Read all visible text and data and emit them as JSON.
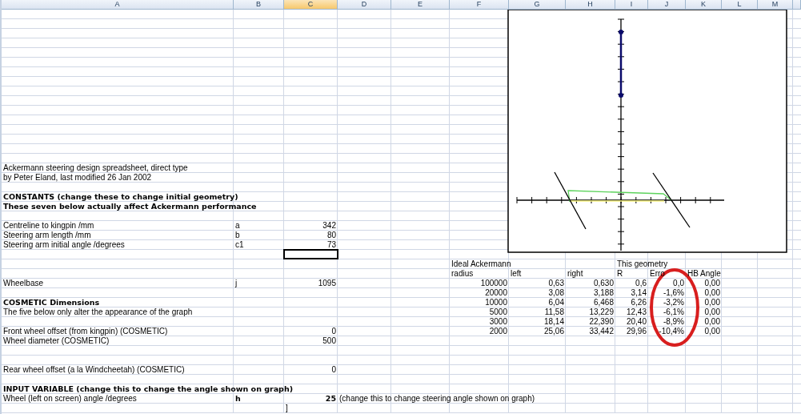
{
  "columns": [
    {
      "label": "A",
      "selected": false
    },
    {
      "label": "B",
      "selected": false
    },
    {
      "label": "C",
      "selected": true
    },
    {
      "label": "D",
      "selected": false
    },
    {
      "label": "E",
      "selected": false
    },
    {
      "label": "F",
      "selected": false
    },
    {
      "label": "G",
      "selected": false
    },
    {
      "label": "H",
      "selected": false
    },
    {
      "label": "I",
      "selected": false
    },
    {
      "label": "J",
      "selected": false
    },
    {
      "label": "K",
      "selected": false
    },
    {
      "label": "L",
      "selected": false
    },
    {
      "label": "M",
      "selected": false
    }
  ],
  "rows": [
    {
      "kind": "blank",
      "selected": false
    },
    {
      "kind": "blank",
      "selected": false
    },
    {
      "kind": "blank",
      "selected": false
    },
    {
      "kind": "blank",
      "selected": false
    },
    {
      "kind": "blank",
      "selected": false
    },
    {
      "kind": "blank",
      "selected": false
    },
    {
      "kind": "blank",
      "selected": false
    },
    {
      "kind": "blank",
      "selected": false
    },
    {
      "kind": "blank",
      "selected": false
    },
    {
      "kind": "blank",
      "selected": false
    },
    {
      "kind": "blank",
      "selected": false
    },
    {
      "kind": "blank",
      "selected": false
    },
    {
      "kind": "blank",
      "selected": false
    },
    {
      "kind": "blank",
      "selected": false
    },
    {
      "kind": "blank",
      "selected": false
    },
    {
      "kind": "blank",
      "selected": false
    },
    {
      "kind": "data",
      "selected": false,
      "cells": [
        {
          "text": "Ackermann steering design spreadsheet, direct type",
          "kind": "text"
        }
      ]
    },
    {
      "kind": "data",
      "selected": false,
      "cells": [
        {
          "text": "by Peter Eland, last modified 26 Jan 2002",
          "kind": "text"
        }
      ]
    },
    {
      "kind": "blank",
      "selected": false
    },
    {
      "kind": "data",
      "selected": false,
      "cells": [
        {
          "text": "CONSTANTS (change these to change initial geometry)",
          "kind": "text",
          "bold": true
        }
      ]
    },
    {
      "kind": "data",
      "selected": false,
      "cells": [
        {
          "text": "These seven below actually affect Ackermann performance",
          "kind": "text",
          "bold": true
        }
      ]
    },
    {
      "kind": "blank",
      "selected": false
    },
    {
      "kind": "data",
      "selected": false,
      "cells": [
        {
          "text": "Centreline to kingpin /mm",
          "kind": "text"
        },
        {
          "text": "a",
          "kind": "text"
        },
        {
          "text": "342",
          "kind": "number"
        }
      ]
    },
    {
      "kind": "data",
      "selected": false,
      "cells": [
        {
          "text": "Steering arm length /mm",
          "kind": "text"
        },
        {
          "text": "b",
          "kind": "text"
        },
        {
          "text": "80",
          "kind": "number"
        }
      ]
    },
    {
      "kind": "data",
      "selected": false,
      "cells": [
        {
          "text": "Steering arm initial angle /degrees",
          "kind": "text"
        },
        {
          "text": "c1",
          "kind": "text"
        },
        {
          "text": "73",
          "kind": "number"
        }
      ]
    },
    {
      "kind": "blank",
      "selected": true
    },
    {
      "kind": "data",
      "selected": false,
      "cells": [
        {},
        {},
        {},
        {},
        {},
        {
          "text": "Ideal Ackermann",
          "kind": "text"
        },
        {},
        {},
        {
          "text": "This geometry",
          "kind": "text"
        }
      ]
    },
    {
      "kind": "data",
      "selected": false,
      "cells": [
        {},
        {},
        {},
        {},
        {},
        {
          "text": "radius",
          "kind": "text"
        },
        {
          "text": "left",
          "kind": "text"
        },
        {
          "text": "right",
          "kind": "text"
        },
        {
          "text": "R",
          "kind": "text"
        },
        {
          "text": "Erro",
          "kind": "text"
        },
        {
          "text": "HB Angle",
          "kind": "text"
        }
      ]
    },
    {
      "kind": "data",
      "selected": false,
      "cells": [
        {
          "text": "Wheelbase",
          "kind": "text"
        },
        {
          "text": "j",
          "kind": "text"
        },
        {
          "text": "1095",
          "kind": "number"
        },
        {},
        {},
        {
          "text": "100000",
          "kind": "number"
        },
        {
          "text": "0,63",
          "kind": "number"
        },
        {
          "text": "0,630",
          "kind": "number"
        },
        {
          "text": "0,6",
          "kind": "number"
        },
        {
          "text": "0,0",
          "kind": "number"
        },
        {
          "text": "0,00",
          "kind": "number"
        }
      ]
    },
    {
      "kind": "data",
      "selected": false,
      "cells": [
        {},
        {},
        {},
        {},
        {},
        {
          "text": "20000",
          "kind": "number"
        },
        {
          "text": "3,08",
          "kind": "number"
        },
        {
          "text": "3,188",
          "kind": "number"
        },
        {
          "text": "3,14",
          "kind": "number"
        },
        {
          "text": "-1,6%",
          "kind": "number"
        },
        {
          "text": "0,00",
          "kind": "number"
        }
      ]
    },
    {
      "kind": "data",
      "selected": false,
      "cells": [
        {
          "text": "COSMETIC Dimensions",
          "kind": "text",
          "bold": true
        },
        {},
        {},
        {},
        {},
        {
          "text": "10000",
          "kind": "number"
        },
        {
          "text": "6,04",
          "kind": "number"
        },
        {
          "text": "6,468",
          "kind": "number"
        },
        {
          "text": "6,26",
          "kind": "number"
        },
        {
          "text": "-3,2%",
          "kind": "number"
        },
        {
          "text": "0,00",
          "kind": "number"
        }
      ]
    },
    {
      "kind": "data",
      "selected": false,
      "cells": [
        {
          "text": "The five below only alter the appearance of the graph",
          "kind": "text"
        },
        {},
        {},
        {},
        {},
        {
          "text": "5000",
          "kind": "number"
        },
        {
          "text": "11,58",
          "kind": "number"
        },
        {
          "text": "13,229",
          "kind": "number"
        },
        {
          "text": "12,43",
          "kind": "number"
        },
        {
          "text": "-6,1%",
          "kind": "number"
        },
        {
          "text": "0,00",
          "kind": "number"
        }
      ]
    },
    {
      "kind": "data",
      "selected": false,
      "cells": [
        {},
        {},
        {},
        {},
        {},
        {
          "text": "3000",
          "kind": "number"
        },
        {
          "text": "18,14",
          "kind": "number"
        },
        {
          "text": "22,390",
          "kind": "number"
        },
        {
          "text": "20,40",
          "kind": "number"
        },
        {
          "text": "-8,9%",
          "kind": "number"
        },
        {
          "text": "0,00",
          "kind": "number"
        }
      ]
    },
    {
      "kind": "data",
      "selected": false,
      "cells": [
        {
          "text": "Front wheel offset (from kingpin) (COSMETIC)",
          "kind": "text"
        },
        {},
        {
          "text": "0",
          "kind": "number"
        },
        {},
        {},
        {
          "text": "2000",
          "kind": "number"
        },
        {
          "text": "25,06",
          "kind": "number"
        },
        {
          "text": "33,442",
          "kind": "number"
        },
        {
          "text": "29,96",
          "kind": "number"
        },
        {
          "text": "-10,4%",
          "kind": "number"
        },
        {
          "text": "0,00",
          "kind": "number"
        }
      ]
    },
    {
      "kind": "data",
      "selected": false,
      "cells": [
        {
          "text": "Wheel diameter (COSMETIC)",
          "kind": "text"
        },
        {},
        {
          "text": "500",
          "kind": "number"
        }
      ]
    },
    {
      "kind": "blank",
      "selected": false
    },
    {
      "kind": "blank",
      "selected": false
    },
    {
      "kind": "data",
      "selected": false,
      "cells": [
        {
          "text": "Rear wheel offset (a la Windcheetah) (COSMETIC)",
          "kind": "text"
        },
        {},
        {
          "text": "0",
          "kind": "number"
        }
      ]
    },
    {
      "kind": "blank",
      "selected": false
    },
    {
      "kind": "data",
      "selected": false,
      "cells": [
        {
          "text": "INPUT VARIABLE (change this to change the angle shown on graph)",
          "kind": "text",
          "bold": true
        }
      ]
    },
    {
      "kind": "data",
      "selected": false,
      "cells": [
        {
          "text": "Wheel (left on screen) angle /degrees",
          "kind": "text"
        },
        {
          "text": "h",
          "kind": "text",
          "bold": true
        },
        {
          "text": "25",
          "kind": "number",
          "bold": true
        },
        {
          "text": "(change this to change steering angle shown on graph)",
          "kind": "text"
        }
      ]
    },
    {
      "kind": "data",
      "selected": false,
      "cells": [
        {},
        {},
        {
          "text": "]",
          "kind": "text"
        }
      ]
    }
  ]
}
